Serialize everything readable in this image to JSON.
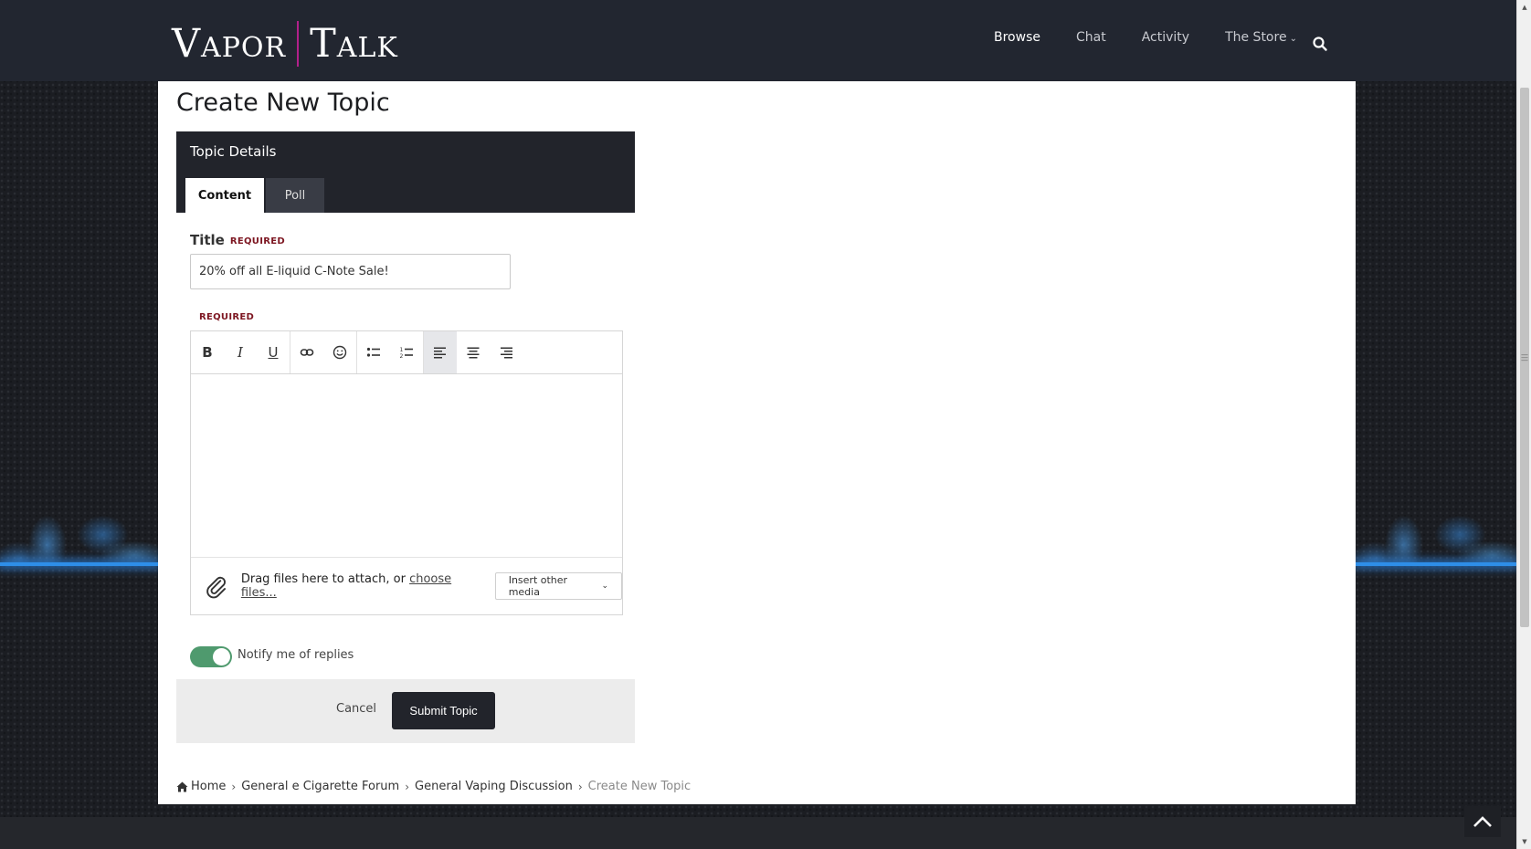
{
  "site": {
    "logo_left": "Vapor",
    "logo_right": "Talk",
    "nav": [
      {
        "label": "Browse"
      },
      {
        "label": "Chat"
      },
      {
        "label": "Activity"
      },
      {
        "label": "The Store"
      }
    ]
  },
  "page": {
    "title": "Create New Topic",
    "section_label": "Topic Details",
    "tabs": [
      {
        "label": "Content",
        "active": true
      },
      {
        "label": "Poll",
        "active": false
      }
    ]
  },
  "form": {
    "title_label": "Title",
    "required": "REQUIRED",
    "title_value": "20% off all E-liquid C-Note Sale!",
    "body_required": "REQUIRED",
    "attach_text": "Drag files here to attach, or ",
    "choose_files": "choose files...",
    "insert_media": "Insert other media",
    "notify_label": "Notify me of replies",
    "notify_on": true,
    "cancel_label": "Cancel",
    "submit_label": "Submit Topic"
  },
  "editor_toolbar": [
    {
      "icon": "bold-icon",
      "glyph": "B"
    },
    {
      "icon": "italic-icon",
      "glyph": "I"
    },
    {
      "icon": "underline-icon",
      "glyph": "U"
    },
    {
      "icon": "link-icon"
    },
    {
      "icon": "emoji-icon"
    },
    {
      "icon": "bullet-list-icon"
    },
    {
      "icon": "numbered-list-icon"
    },
    {
      "icon": "align-left-icon",
      "active": true
    },
    {
      "icon": "align-center-icon"
    },
    {
      "icon": "align-right-icon"
    }
  ],
  "breadcrumb": [
    {
      "label": "Home"
    },
    {
      "label": "General e Cigarette Forum"
    },
    {
      "label": "General Vaping Discussion"
    },
    {
      "label": "Create New Topic",
      "current": true
    }
  ],
  "colors": {
    "header_bg": "#222630",
    "logo_divider": "#b2208a",
    "toggle_on": "#4f9a6e",
    "required_text": "#7d1621",
    "submit_bg": "#22242b"
  }
}
